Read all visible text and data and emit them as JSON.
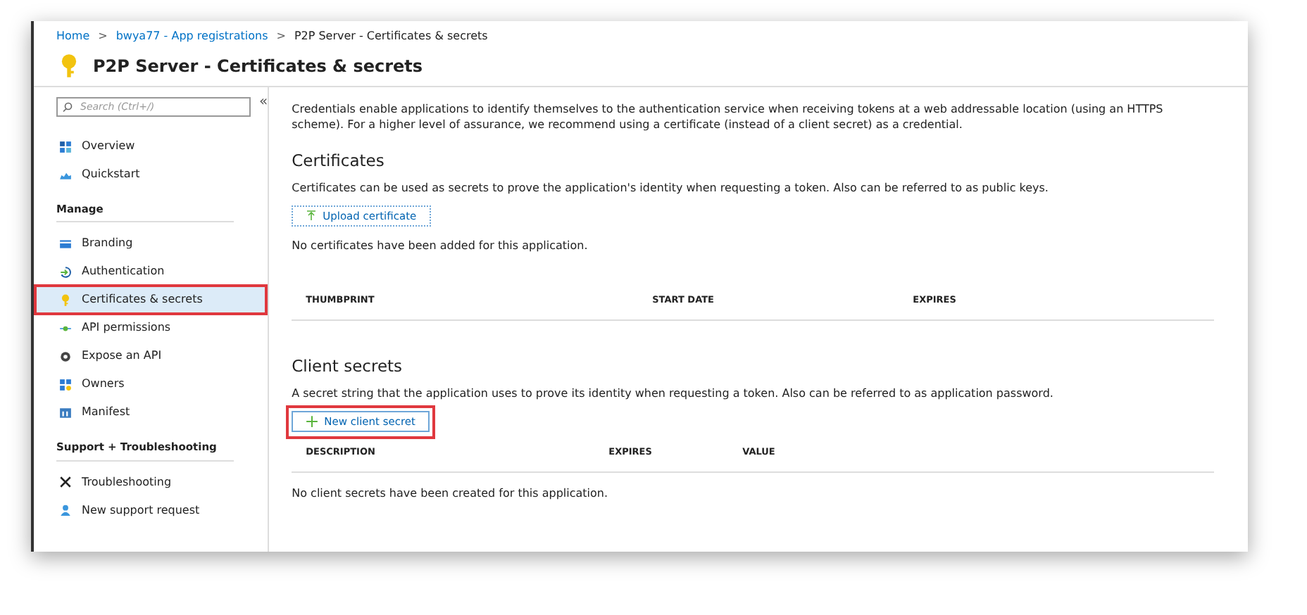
{
  "breadcrumb": [
    {
      "label": "Home",
      "kind": "link"
    },
    {
      "label": "bwya77 - App registrations",
      "kind": "link"
    },
    {
      "label": "P2P Server - Certificates & secrets",
      "kind": "current"
    }
  ],
  "breadcrumb_separator": ">",
  "page_title": "P2P Server - Certificates & secrets",
  "sidebar": {
    "search": {
      "placeholder": "Search (Ctrl+/)"
    },
    "collapse": "«",
    "sections": [
      {
        "items": [
          {
            "label": "Overview",
            "selected": false,
            "highlighted": false
          },
          {
            "label": "Quickstart",
            "selected": false,
            "highlighted": false
          }
        ]
      },
      {
        "heading": "Manage",
        "items": [
          {
            "label": "Branding",
            "selected": false,
            "highlighted": false
          },
          {
            "label": "Authentication",
            "selected": false,
            "highlighted": false
          },
          {
            "label": "Certificates & secrets",
            "selected": true,
            "highlighted": true
          },
          {
            "label": "API permissions",
            "selected": false,
            "highlighted": false
          },
          {
            "label": "Expose an API",
            "selected": false,
            "highlighted": false
          },
          {
            "label": "Owners",
            "selected": false,
            "highlighted": false
          },
          {
            "label": "Manifest",
            "selected": false,
            "highlighted": false
          }
        ]
      },
      {
        "heading": "Support + Troubleshooting",
        "items": [
          {
            "label": "Troubleshooting",
            "selected": false,
            "highlighted": false
          },
          {
            "label": "New support request",
            "selected": false,
            "highlighted": false
          }
        ]
      }
    ]
  },
  "intro": "Credentials enable applications to identify themselves to the authentication service when receiving tokens at a web addressable location (using an HTTPS scheme). For a higher level of assurance, we recommend using a certificate (instead of a client secret) as a credential.",
  "sections": [
    {
      "kind": "upload",
      "title": "Certificates",
      "description": "Certificates can be used as secrets to prove the application's identity when requesting a token. Also can be referred to as public keys.",
      "button": {
        "label": "Upload certificate",
        "highlighted": false
      },
      "empty_before": "No certificates have been added for this application.",
      "columns": [
        "THUMBPRINT",
        "START DATE",
        "EXPIRES"
      ]
    },
    {
      "kind": "add",
      "title": "Client secrets",
      "description": "A secret string that the application uses to prove its identity when requesting a token. Also can be referred to as application password.",
      "button": {
        "label": "New client secret",
        "highlighted": true
      },
      "columns": [
        "DESCRIPTION",
        "EXPIRES",
        "VALUE"
      ],
      "empty_after": "No client secrets have been created for this application."
    }
  ]
}
